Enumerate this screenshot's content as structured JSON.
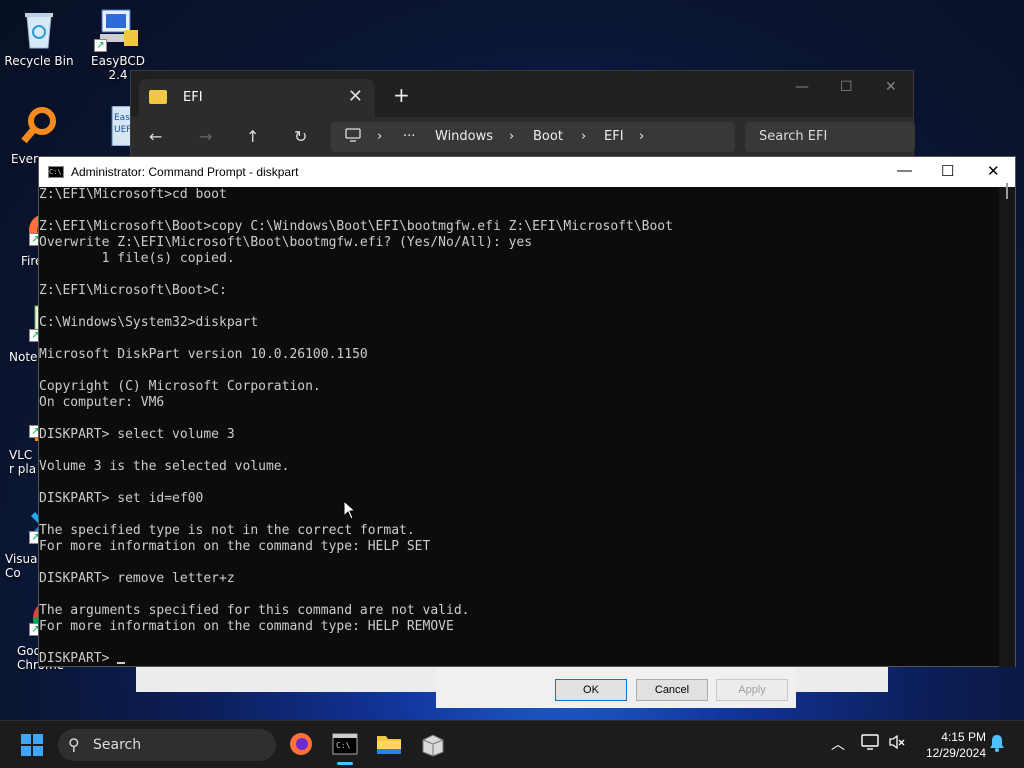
{
  "desktop": {
    "icons": [
      {
        "label": "Recycle Bin"
      },
      {
        "label": "EasyBCD 2.4"
      },
      {
        "label": "Every"
      },
      {
        "label": "Fire"
      },
      {
        "label": "Notep"
      },
      {
        "label": "VLC r pla"
      },
      {
        "label": "Visual Co"
      },
      {
        "label": "Goo Chrome"
      }
    ]
  },
  "explorer": {
    "tab_title": "EFI",
    "breadcrumb": [
      "Windows",
      "Boot",
      "EFI"
    ],
    "ellipsis": "···",
    "search_placeholder": "Search EFI"
  },
  "properties_dialog": {
    "ok": "OK",
    "cancel": "Cancel",
    "apply": "Apply"
  },
  "cmd": {
    "title": "Administrator: Command Prompt - diskpart",
    "icon_text": "C:\\",
    "lines": [
      "Z:\\EFI\\Microsoft>cd boot",
      "",
      "Z:\\EFI\\Microsoft\\Boot>copy C:\\Windows\\Boot\\EFI\\bootmgfw.efi Z:\\EFI\\Microsoft\\Boot",
      "Overwrite Z:\\EFI\\Microsoft\\Boot\\bootmgfw.efi? (Yes/No/All): yes",
      "        1 file(s) copied.",
      "",
      "Z:\\EFI\\Microsoft\\Boot>C:",
      "",
      "C:\\Windows\\System32>diskpart",
      "",
      "Microsoft DiskPart version 10.0.26100.1150",
      "",
      "Copyright (C) Microsoft Corporation.",
      "On computer: VM6",
      "",
      "DISKPART> select volume 3",
      "",
      "Volume 3 is the selected volume.",
      "",
      "DISKPART> set id=ef00",
      "",
      "The specified type is not in the correct format.",
      "For more information on the command type: HELP SET",
      "",
      "DISKPART> remove letter+z",
      "",
      "The arguments specified for this command are not valid.",
      "For more information on the command type: HELP REMOVE",
      "",
      "DISKPART> "
    ]
  },
  "taskbar": {
    "search_label": "Search",
    "time": "4:15 PM",
    "date": "12/29/2024"
  },
  "colors": {
    "accent": "#3ea6ff",
    "console_text": "#cccccc",
    "console_bg": "#0c0c0c"
  }
}
